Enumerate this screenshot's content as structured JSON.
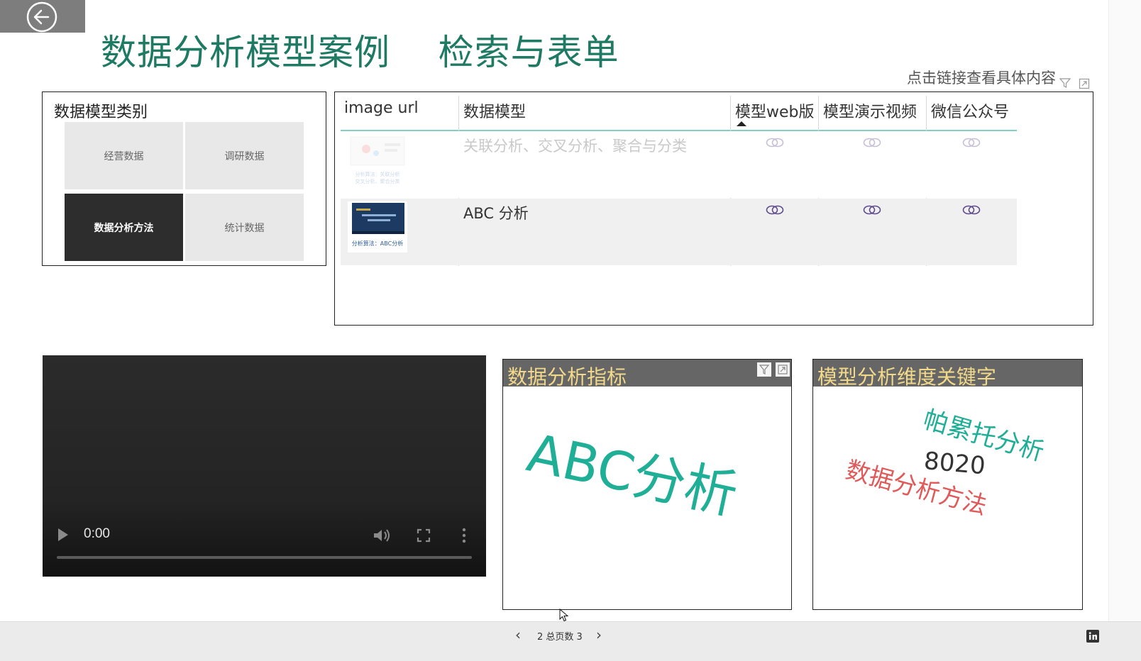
{
  "header": {
    "back_icon": "arrow-left-circle-icon",
    "title": "数据分析模型案例    检索与表单",
    "link_hint": "点击链接查看具体内容"
  },
  "category_panel": {
    "title": "数据模型类别",
    "items": [
      {
        "label": "经营数据",
        "selected": false
      },
      {
        "label": "调研数据",
        "selected": false
      },
      {
        "label": "数据分析方法",
        "selected": true
      },
      {
        "label": "统计数据",
        "selected": false
      }
    ]
  },
  "table": {
    "headers": [
      "image url",
      "数据模型",
      "模型web版",
      "模型演示视频",
      "微信公众号"
    ],
    "sorted_column": "模型web版",
    "rows": [
      {
        "model": "关联分析、交叉分析、聚合与分类",
        "dimmed": true,
        "thumb_caption": "分析算法：关联分析、交叉分析、聚合分类"
      },
      {
        "model": "ABC 分析",
        "dimmed": false,
        "thumb_caption": "分析算法：ABC分析"
      }
    ],
    "link_icon": "chain-link-icon",
    "accent_color": "#7fcfc2"
  },
  "video": {
    "time": "0:00",
    "progress": 0
  },
  "indicator_card": {
    "title": "数据分析指标",
    "words": [
      {
        "text": "ABC分析",
        "color": "#1fae96"
      }
    ]
  },
  "keyword_card": {
    "title": "模型分析维度关键字",
    "words": [
      {
        "text": "帕累托分析",
        "color": "#1fae96"
      },
      {
        "text": "8020",
        "color": "#333333"
      },
      {
        "text": "数据分析方法",
        "color": "#e05a5a"
      }
    ]
  },
  "pager": {
    "label": "2 总页数 3"
  },
  "colors": {
    "title_green": "#1e7a63",
    "card_title_gold": "#f2d98a"
  }
}
